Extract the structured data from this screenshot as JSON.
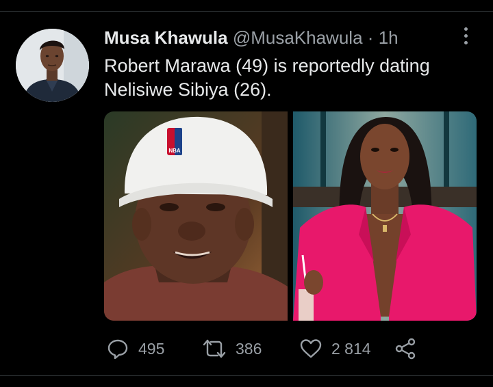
{
  "tweet": {
    "display_name": "Musa Khawula",
    "handle": "@MusaKhawula",
    "separator": "·",
    "time": "1h",
    "text": "Robert Marawa (49) is reportedly dating Nelisiwe Sibiya (26)."
  },
  "media": {
    "photos": [
      {
        "name": "man-in-nba-cap",
        "cap_logo_text": "NBA"
      },
      {
        "name": "woman-in-pink-blazer"
      }
    ]
  },
  "actions": {
    "reply_count": "495",
    "retweet_count": "386",
    "like_count": "2 814",
    "icons": [
      "reply-icon",
      "retweet-icon",
      "like-icon",
      "share-icon"
    ]
  },
  "colors": {
    "background": "#000000",
    "text_primary": "#e7e9ea",
    "text_secondary": "#9aa0a6",
    "jacket_pink": "#e8186b"
  }
}
